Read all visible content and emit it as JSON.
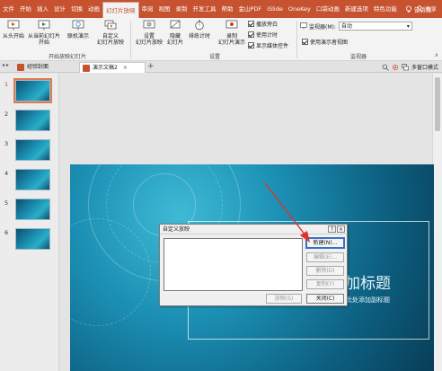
{
  "ribbon_tabs": [
    "文件",
    "开始",
    "插入",
    "设计",
    "切换",
    "动画",
    "幻灯片放映",
    "审阅",
    "视图",
    "录制",
    "开发工具",
    "帮助",
    "金山PDF",
    "iSlide",
    "OneKey",
    "口袋动画",
    "新建选项",
    "特色功能"
  ],
  "active_tab_index": 6,
  "tell_me": "告诉我",
  "share": "共享",
  "ribbon": {
    "from_beginning": "从头开始",
    "from_current_l1": "从当前幻灯片",
    "from_current_l2": "开始",
    "online_l1": "联机演示",
    "custom_l1": "自定义",
    "custom_l2": "幻灯片放映",
    "group_start": "开始放映幻灯片",
    "setup_l1": "设置",
    "setup_l2": "幻灯片放映",
    "hide_l1": "隐藏",
    "hide_l2": "幻灯片",
    "rehearse": "排练计时",
    "record_l1": "录制",
    "record_l2": "幻灯片演示",
    "chk_narration": "播放旁白",
    "chk_timing": "使用计时",
    "chk_media": "显示媒体控件",
    "group_setup": "设置",
    "monitor_label": "监视器(M):",
    "monitor_value": "自动",
    "presenter_view": "使用演示者视图",
    "group_monitor": "监视器"
  },
  "doc_tabs": {
    "tab1": "经验封面",
    "tab2": "演示文稿2",
    "close": "×",
    "plus": "+",
    "multi_window": "多窗口模式"
  },
  "slides": [
    "1",
    "2",
    "3",
    "4",
    "5",
    "6"
  ],
  "selected_slide": 1,
  "slide_content": {
    "title": "加标题",
    "subtitle": "击此处添加副标题"
  },
  "dialog": {
    "title": "自定义放映",
    "help": "?",
    "close_x": "×",
    "new_btn": "新建(N)...",
    "edit_btn": "编辑(E)...",
    "delete_btn": "删除(D)",
    "copy_btn": "复制(Y)",
    "show_btn": "放映(S)",
    "close_btn": "关闭(C)"
  },
  "colors": {
    "accent": "#c6522f",
    "arrow": "#e0322b"
  }
}
